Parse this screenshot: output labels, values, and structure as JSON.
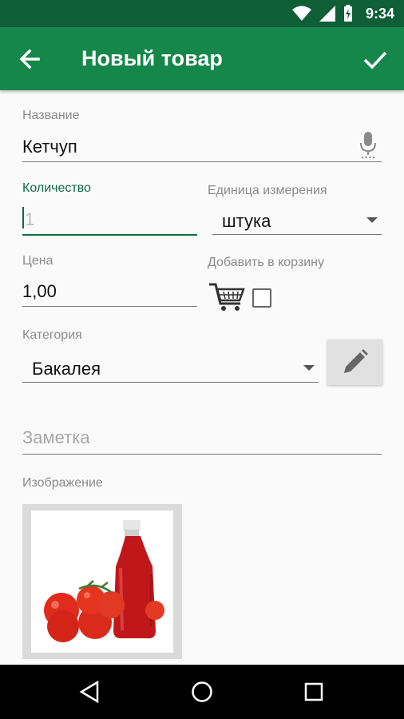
{
  "status_bar": {
    "time": "9:34",
    "icons": [
      "wifi-icon",
      "signal-icon",
      "battery-charging-icon"
    ]
  },
  "app_bar": {
    "title": "Новый товар",
    "back_icon": "arrow-left-icon",
    "confirm_icon": "check-icon"
  },
  "form": {
    "name": {
      "label": "Название",
      "value": "Кетчуп",
      "icon": "microphone-icon"
    },
    "quantity": {
      "label": "Количество",
      "placeholder": "1"
    },
    "unit": {
      "label": "Единица измерения",
      "selected": "штука"
    },
    "price": {
      "label": "Цена",
      "value": "1,00"
    },
    "add_to_cart": {
      "label": "Добавить в корзину",
      "checked": false,
      "icon": "cart-icon"
    },
    "category": {
      "label": "Категория",
      "selected": "Бакалея",
      "edit_icon": "pencil-icon"
    },
    "note": {
      "placeholder": "Заметка"
    },
    "image": {
      "label": "Изображение",
      "content": "ketchup-bottle-with-tomatoes"
    }
  },
  "nav_bar": {
    "buttons": [
      "back-triangle-icon",
      "home-circle-icon",
      "recents-square-icon"
    ]
  },
  "colors": {
    "status_bar": "#0e5e36",
    "app_bar": "#16874a",
    "accent": "#0f6b46"
  }
}
